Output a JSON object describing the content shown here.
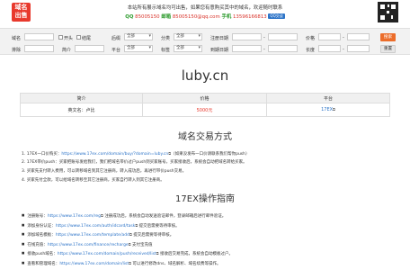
{
  "header": {
    "logo_line1": "域名",
    "logo_line2": "出售",
    "notice": "本站所有展示域名均可出售，如果您有意购买其中的域名，欢迎随时联系",
    "qq_label": "QQ",
    "qq_value": "85005150",
    "email_label": "邮箱",
    "email_value": "85005150@qq.com",
    "phone_label": "手机",
    "phone_value": "13596166813",
    "qq_badge": "QQ交谈"
  },
  "filter": {
    "row1": {
      "suffix_label": "域名",
      "prefix_label": "开头",
      "suffix_cb_label": "结尾",
      "backend_label": "后缀",
      "backend_value": "全部",
      "category_label": "分类",
      "category_value": "全部",
      "reg_date_label": "注册日期",
      "reg_date_sep": "-",
      "price_label": "价格",
      "price_sep": "-",
      "search_button": "搜索"
    },
    "row2": {
      "exclude_label": "排除",
      "intro_label": "简介",
      "platform_label": "平台",
      "platform_value": "全部",
      "tag_label": "标签",
      "tag_value": "全部",
      "expire_label": "到期日期",
      "expire_sep": "-",
      "length_label": "长度",
      "length_sep": "-",
      "reset_button": "重置"
    }
  },
  "domain": "luby.cn",
  "table": {
    "headers": [
      "简介",
      "价格",
      "平台"
    ],
    "row": {
      "intro": "英文名：卢比",
      "price": "5000元",
      "platform": "17EX"
    }
  },
  "section1_title": "域名交易方式",
  "steps": [
    {
      "pre": "1. 17EX一口价购买：",
      "link": "https://www.17ex.com/domain/buy/?domain=luby.cn",
      "post": "（如果没发布一口价请联系我们帮你push）"
    },
    {
      "pre": "2. 17EX带价push：买家把账号发给我们，我们把域名带价过户push到买家账号，买家接收后，系统会自动把域名转给买家。",
      "link": "",
      "post": ""
    },
    {
      "pre": "3. 买家先支付转入费用，可以转移域名到其它注册商，转入成功后，再进行带价push交易。",
      "link": "",
      "post": ""
    },
    {
      "pre": "4. 买家先付全款，可以给域名转移至其它注册商，买家自行转入到其它注册商。",
      "link": "",
      "post": ""
    }
  ],
  "section2_title": "17EX操作指南",
  "guides": [
    {
      "pre": "注册账号：",
      "link": "https://www.17ex.com/reg",
      "post": "注册成功后，系统会自动发送验证邮件，登录邮箱后进行邮件验证。"
    },
    {
      "pre": "添加身份认证：",
      "link": "https://www.17ex.com/auth/idcard/task",
      "post": "提交后需要等待审核。"
    },
    {
      "pre": "添加域名模板：",
      "link": "https://www.17ex.com/template/add",
      "post": "提交后需要等待审核。"
    },
    {
      "pre": "在线充值：",
      "link": "https://www.17ex.com/finance/recharge",
      "post": "支付宝充值"
    },
    {
      "pre": "接收push域名：",
      "link": "https://www.17ex.com/domain/push/received/list",
      "post": "接收后交易完成，系统会自动模板过户。"
    },
    {
      "pre": "查看和管理域名：",
      "link": "https://www.17ex.com/domain/list",
      "post": "可以进行修改dns、域名解析、域名续费等操作。"
    }
  ]
}
